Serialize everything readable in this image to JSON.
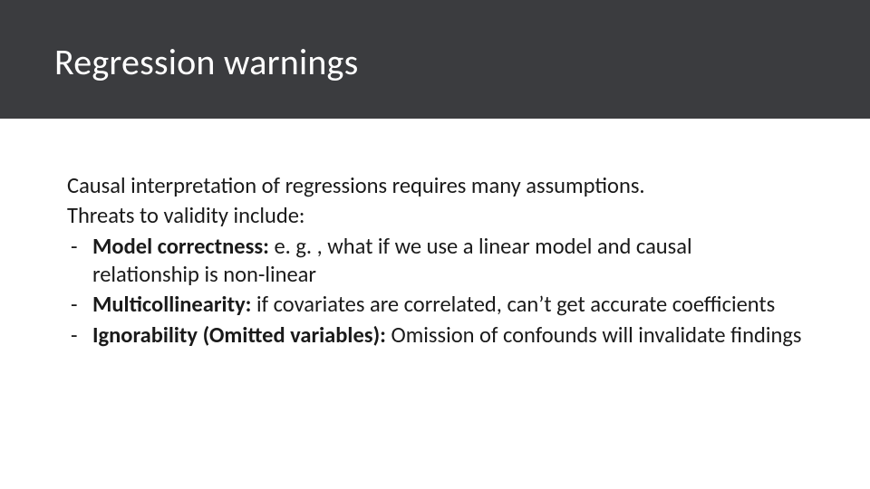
{
  "slide": {
    "title": "Regression warnings",
    "intro_line_1": "Causal interpretation of regressions requires many assumptions.",
    "intro_line_2": "Threats to validity include:",
    "bullets": [
      {
        "term": "Model correctness:",
        "rest": " e. g. , what if we use a linear model and causal relationship is non-linear"
      },
      {
        "term": "Multicollinearity:",
        "rest": " if covariates are correlated, can’t get accurate coefficients"
      },
      {
        "term": "Ignorability (Omitted variables):",
        "rest": " Omission of confounds will invalidate findings"
      }
    ]
  }
}
